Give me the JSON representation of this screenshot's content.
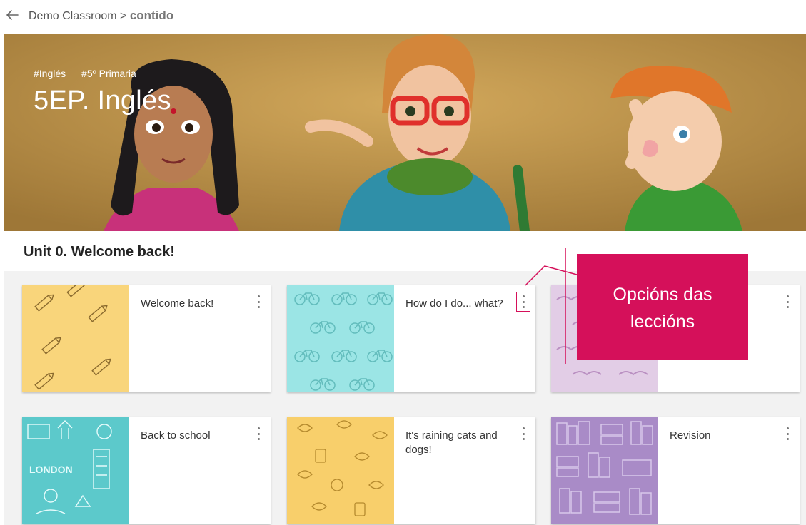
{
  "breadcrumb": {
    "parent": "Demo Classroom >",
    "current": "contido"
  },
  "hero": {
    "tags": [
      "#Inglés",
      "#5º Primaria"
    ],
    "title": "5EP. Inglés"
  },
  "unit": {
    "title": "Unit 0. Welcome back!"
  },
  "lessons": [
    {
      "title": "Welcome back!",
      "pattern": "pencils",
      "bg": "#f9d57b"
    },
    {
      "title": "How do I do... what?",
      "pattern": "bicycles",
      "bg": "#9be5e5"
    },
    {
      "title": "",
      "pattern": "moustaches",
      "bg": "#e2cde6"
    },
    {
      "title": "Back to school",
      "pattern": "london",
      "bg": "#5cc9cb"
    },
    {
      "title": "It's raining cats and dogs!",
      "pattern": "leaves",
      "bg": "#f8cf6b"
    },
    {
      "title": "Revision",
      "pattern": "books",
      "bg": "#a98bc7"
    }
  ],
  "thumb_text": {
    "london": "LONDON"
  },
  "callout": {
    "text": "Opcións das\nleccións"
  },
  "colors": {
    "accent": "#d5105a",
    "hero_bg": "#c49a4f"
  },
  "icons": {
    "back": "arrow-left-icon",
    "options": "more-vertical-icon"
  }
}
